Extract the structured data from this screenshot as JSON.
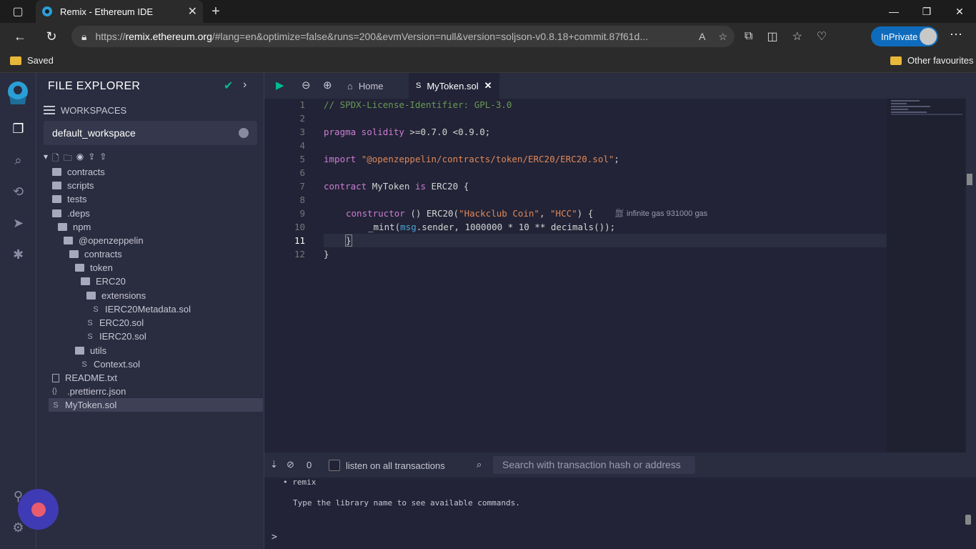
{
  "browser": {
    "tab_title": "Remix - Ethereum IDE",
    "tab_close": "✕",
    "new_tab": "+",
    "url_prefix": "https://",
    "url_host": "remix.ethereum.org",
    "url_path": "/#lang=en&optimize=false&runs=200&evmVersion=null&version=soljson-v0.8.18+commit.87f61d...",
    "inprivate_label": "InPrivate",
    "fav_saved": "Saved",
    "fav_other": "Other favourites",
    "accent": "#0f6cbd"
  },
  "sidebar": {
    "title": "FILE EXPLORER",
    "workspaces_label": "WORKSPACES",
    "workspace_name": "default_workspace",
    "tree": [
      {
        "label": "contracts",
        "type": "folder"
      },
      {
        "label": "scripts",
        "type": "folder"
      },
      {
        "label": "tests",
        "type": "folder"
      },
      {
        "label": ".deps",
        "type": "folder"
      },
      {
        "label": "npm",
        "type": "folder"
      },
      {
        "label": "@openzeppelin",
        "type": "folder"
      },
      {
        "label": "contracts",
        "type": "folder"
      },
      {
        "label": "token",
        "type": "folder"
      },
      {
        "label": "ERC20",
        "type": "folder"
      },
      {
        "label": "extensions",
        "type": "folder"
      },
      {
        "label": "IERC20Metadata.sol",
        "type": "sol"
      },
      {
        "label": "ERC20.sol",
        "type": "sol"
      },
      {
        "label": "IERC20.sol",
        "type": "sol"
      },
      {
        "label": "utils",
        "type": "folder"
      },
      {
        "label": "Context.sol",
        "type": "sol"
      },
      {
        "label": "README.txt",
        "type": "file"
      },
      {
        "label": ".prettierrc.json",
        "type": "json"
      },
      {
        "label": "MyToken.sol",
        "type": "sol"
      }
    ]
  },
  "editor": {
    "tab_home": "Home",
    "tab_file": "MyToken.sol",
    "line_numbers": [
      "1",
      "2",
      "3",
      "4",
      "5",
      "6",
      "7",
      "8",
      "9",
      "10",
      "11",
      "12"
    ],
    "current_line": 11,
    "code": {
      "l1": "// SPDX-License-Identifier: GPL-3.0",
      "l3_kw": "pragma solidity",
      "l3_rest": " >=0.7.0 <0.9.0;",
      "l5_kw": "import",
      "l5_str": "\"@openzeppelin/contracts/token/ERC20/ERC20.sol\"",
      "l5_end": ";",
      "l7_kw1": "contract",
      "l7_name": " MyToken ",
      "l7_kw2": "is",
      "l7_rest": " ERC20 {",
      "l9_kw": "constructor",
      "l9_a": " () ERC20(",
      "l9_s1": "\"Hackclub Coin\"",
      "l9_b": ", ",
      "l9_s2": "\"HCC\"",
      "l9_c": ") {",
      "l10_a": "_mint(",
      "l10_msg": "msg",
      "l10_b": ".sender, 1000000 * 10 ** decimals());",
      "l11": "}",
      "l12": "}"
    },
    "gas_hint": "infinite gas 931000 gas"
  },
  "terminal": {
    "count": "0",
    "listen_label": "listen on all transactions",
    "search_placeholder": "Search with transaction hash or address",
    "lib_item": "remix",
    "help_text": "Type the library name to see available commands.",
    "prompt": ">"
  }
}
